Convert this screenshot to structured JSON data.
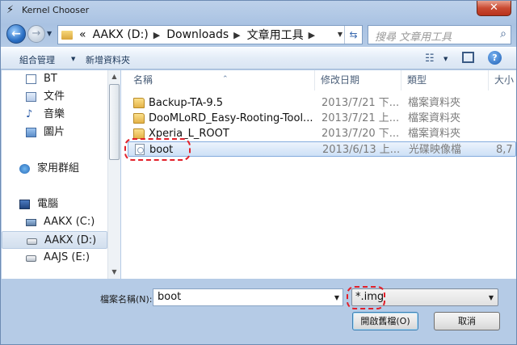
{
  "window": {
    "title": "Kernel Chooser",
    "close_label": "✕"
  },
  "nav": {
    "breadcrumbs": [
      "AAKX (D:)",
      "Downloads",
      "文章用工具"
    ],
    "breadcrumb_prefix": "«",
    "search_placeholder": "搜尋 文章用工具"
  },
  "toolbar": {
    "organize": "組合管理",
    "new_folder": "新增資料夾",
    "help": "?"
  },
  "sidebar": {
    "libraries": [
      {
        "label": "BT",
        "icon": "document-icon"
      },
      {
        "label": "文件",
        "icon": "documents-icon"
      },
      {
        "label": "音樂",
        "icon": "music-icon"
      },
      {
        "label": "圖片",
        "icon": "pictures-icon"
      }
    ],
    "homegroup": {
      "label": "家用群組",
      "icon": "homegroup-icon"
    },
    "computer": {
      "label": "電腦",
      "icon": "computer-icon"
    },
    "drives": [
      {
        "label": "AAKX (C:)",
        "icon": "system-drive-icon",
        "selected": false
      },
      {
        "label": "AAKX (D:)",
        "icon": "drive-icon",
        "selected": true
      },
      {
        "label": "AAJS (E:)",
        "icon": "drive-icon",
        "selected": false
      }
    ]
  },
  "files": {
    "columns": {
      "name": "名稱",
      "date": "修改日期",
      "type": "類型",
      "size": "大小"
    },
    "rows": [
      {
        "name": "Backup-TA-9.5",
        "date": "2013/7/21 下...",
        "type": "檔案資料夾",
        "size": "",
        "kind": "folder",
        "selected": false
      },
      {
        "name": "DooMLoRD_Easy-Rooting-Tool...",
        "date": "2013/7/21 上...",
        "type": "檔案資料夾",
        "size": "",
        "kind": "folder",
        "selected": false
      },
      {
        "name": "Xperia_L_ROOT",
        "date": "2013/7/20 下...",
        "type": "檔案資料夾",
        "size": "",
        "kind": "folder",
        "selected": false
      },
      {
        "name": "boot",
        "date": "2013/6/13 上...",
        "type": "光碟映像檔",
        "size": "8,7",
        "kind": "image",
        "selected": true
      }
    ]
  },
  "bottom": {
    "filename_label": "檔案名稱(N):",
    "filename_value": "boot",
    "filter_value": "*.img",
    "open_label": "開啟舊檔(O)",
    "cancel_label": "取消"
  },
  "colors": {
    "highlight": "#e2202a",
    "selection": "#cde0f6"
  }
}
